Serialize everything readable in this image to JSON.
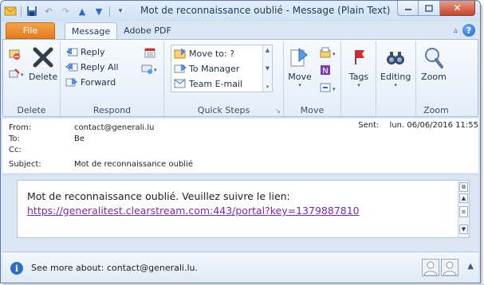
{
  "window": {
    "title": "Mot de reconnaissance oublié - Message (Plain Text)"
  },
  "tabs": {
    "file": "File",
    "message": "Message",
    "adobe": "Adobe PDF"
  },
  "ribbon": {
    "delete_group": {
      "label": "Delete",
      "delete_button": "Delete"
    },
    "respond_group": {
      "label": "Respond",
      "reply": "Reply",
      "reply_all": "Reply All",
      "forward": "Forward"
    },
    "quick_steps_group": {
      "label": "Quick Steps",
      "items": [
        "Move to: ?",
        "To Manager",
        "Team E-mail"
      ]
    },
    "move_group": {
      "label": "Move",
      "move_button": "Move"
    },
    "tags_group": {
      "tags_button": "Tags"
    },
    "editing_group": {
      "editing_button": "Editing"
    },
    "zoom_group": {
      "label": "Zoom",
      "zoom_button": "Zoom"
    }
  },
  "header": {
    "from_label": "From:",
    "from_value": "contact@generali.lu",
    "to_label": "To:",
    "to_value": "Be",
    "cc_label": "Cc:",
    "cc_value": "",
    "subject_label": "Subject:",
    "subject_value": "Mot de reconnaissance oublié",
    "sent_label": "Sent:",
    "sent_value": "lun. 06/06/2016 11:55"
  },
  "body": {
    "line1": "Mot de reconnaissance oublié. Veuillez suivre le lien:",
    "link": "https://generalitest.clearstream.com:443/portal?key=1379887810"
  },
  "people_pane": {
    "see_more": "See more about: contact@generali.lu."
  },
  "colors": {
    "file_tab": "#e67a1c",
    "link": "#7a2aa3",
    "close_button": "#c7432c"
  }
}
